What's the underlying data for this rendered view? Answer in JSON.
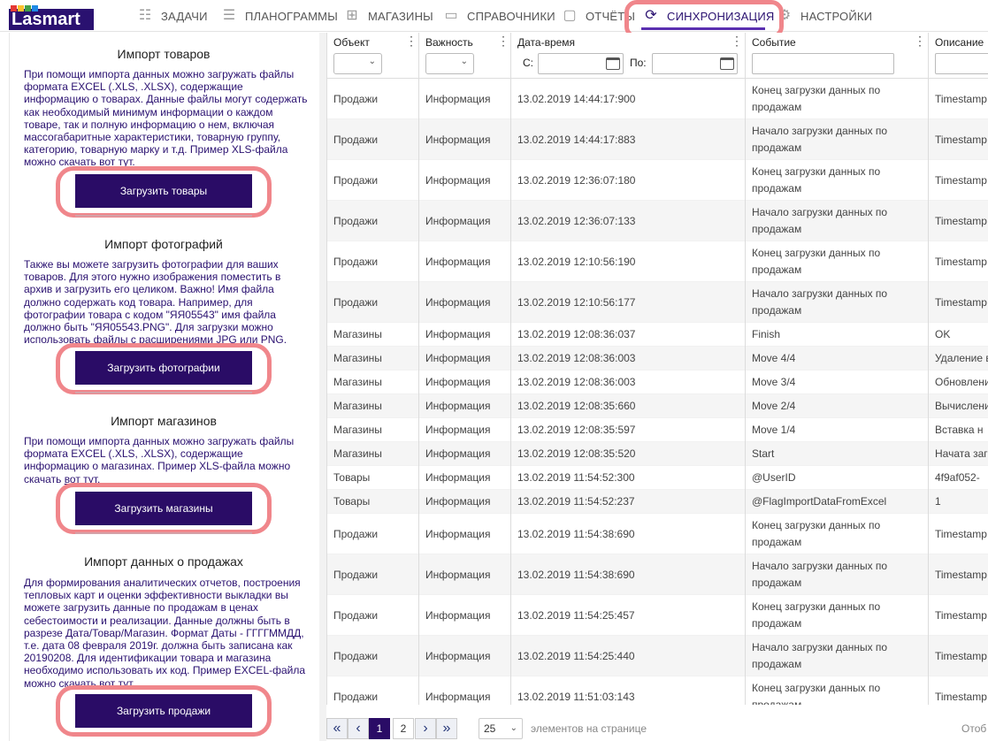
{
  "brand": {
    "logo_text": "Lasmart",
    "logo_colors": [
      "#e53935",
      "#fbc02d",
      "#43a047",
      "#1e88e5"
    ]
  },
  "nav": {
    "items": [
      {
        "label": "ЗАДАЧИ",
        "icon": "checklist-icon"
      },
      {
        "label": "ПЛАНОГРАММЫ",
        "icon": "shelves-icon"
      },
      {
        "label": "МАГАЗИНЫ",
        "icon": "store-icon"
      },
      {
        "label": "СПРАВОЧНИКИ",
        "icon": "folder-icon"
      },
      {
        "label": "ОТЧЁТЫ",
        "icon": "document-icon"
      },
      {
        "label": "СИНХРОНИЗАЦИЯ",
        "icon": "sync-icon",
        "active": true
      },
      {
        "label": "НАСТРОЙКИ",
        "icon": "gear-icon"
      }
    ]
  },
  "sections": [
    {
      "title": "Импорт товаров",
      "text": "При помощи импорта данных можно загружать файлы формата EXCEL (.XLS, .XLSX), содержащие информацию о товарах. Данные файлы могут содержать как необходимый минимум информации о каждом товаре, так и полную информацию о нем, включая массогабаритные характеристики, товарную группу, категорию, товарную марку и т.д. Пример XLS-файла можно скачать",
      "link": "вот тут.",
      "button": "Загрузить товары"
    },
    {
      "title": "Импорт фотографий",
      "text": "Также вы можете загрузить фотографии для ваших товаров. Для этого нужно изображения поместить в архив и загрузить его целиком. Важно! Имя файла должно содержать код товара. Например, для фотографии товара с кодом \"ЯЯ05543\" имя файла должно быть \"ЯЯ05543.PNG\". Для загрузки можно использовать файлы с расширениями JPG или PNG.",
      "link": "",
      "button": "Загрузить фотографии"
    },
    {
      "title": "Импорт магазинов",
      "text": "При помощи импорта данных можно загружать файлы формата EXCEL (.XLS, .XLSX), содержащие информацию о магазинах. Пример XLS-файла можно скачать",
      "link": "вот тут.",
      "button": "Загрузить магазины"
    },
    {
      "title": "Импорт данных о продажах",
      "text": "Для формирования аналитических отчетов, построения тепловых карт и оценки эффективности выкладки вы можете загрузить данные по продажам в ценах себестоимости и реализации. Данные должны быть в разрезе Дата/Товар/Магазин. Формат Даты - ГГГГММДД, т.е. дата 08 февраля 2019г. должна быть записана как 20190208. Для идентификации товара и магазина необходимо использовать их код. Пример EXCEL-файла можно скачать",
      "link": "вот тут.",
      "button": "Загрузить продажи"
    }
  ],
  "grid": {
    "columns": [
      "Объект",
      "Важность",
      "Дата-время",
      "Событие",
      "Описание"
    ],
    "filter": {
      "from_label": "С:",
      "to_label": "По:"
    },
    "rows": [
      [
        "Продажи",
        "Информация",
        "13.02.2019 14:44:17:900",
        "Конец загрузки данных по продажам",
        "Timestamp"
      ],
      [
        "Продажи",
        "Информация",
        "13.02.2019 14:44:17:883",
        "Начало загрузки данных по продажам",
        "Timestamp"
      ],
      [
        "Продажи",
        "Информация",
        "13.02.2019 12:36:07:180",
        "Конец загрузки данных по продажам",
        "Timestamp"
      ],
      [
        "Продажи",
        "Информация",
        "13.02.2019 12:36:07:133",
        "Начало загрузки данных по продажам",
        "Timestamp"
      ],
      [
        "Продажи",
        "Информация",
        "13.02.2019 12:10:56:190",
        "Конец загрузки данных по продажам",
        "Timestamp"
      ],
      [
        "Продажи",
        "Информация",
        "13.02.2019 12:10:56:177",
        "Начало загрузки данных по продажам",
        "Timestamp"
      ],
      [
        "Магазины",
        "Информация",
        "13.02.2019 12:08:36:037",
        "Finish",
        "OK"
      ],
      [
        "Магазины",
        "Информация",
        "13.02.2019 12:08:36:003",
        "Move 4/4",
        "Удаление в"
      ],
      [
        "Магазины",
        "Информация",
        "13.02.2019 12:08:36:003",
        "Move 3/4",
        "Обновлени"
      ],
      [
        "Магазины",
        "Информация",
        "13.02.2019 12:08:35:660",
        "Move 2/4",
        "Вычислени"
      ],
      [
        "Магазины",
        "Информация",
        "13.02.2019 12:08:35:597",
        "Move 1/4",
        "Вставка н"
      ],
      [
        "Магазины",
        "Информация",
        "13.02.2019 12:08:35:520",
        "Start",
        "Начата заг"
      ],
      [
        "Товары",
        "Информация",
        "13.02.2019 11:54:52:300",
        "@UserID",
        "4f9af052-"
      ],
      [
        "Товары",
        "Информация",
        "13.02.2019 11:54:52:237",
        "@FlagImportDataFromExcel",
        "1"
      ],
      [
        "Продажи",
        "Информация",
        "13.02.2019 11:54:38:690",
        "Конец загрузки данных по продажам",
        "Timestamp"
      ],
      [
        "Продажи",
        "Информация",
        "13.02.2019 11:54:38:690",
        "Начало загрузки данных по продажам",
        "Timestamp"
      ],
      [
        "Продажи",
        "Информация",
        "13.02.2019 11:54:25:457",
        "Конец загрузки данных по продажам",
        "Timestamp"
      ],
      [
        "Продажи",
        "Информация",
        "13.02.2019 11:54:25:440",
        "Начало загрузки данных по продажам",
        "Timestamp"
      ],
      [
        "Продажи",
        "Информация",
        "13.02.2019 11:51:03:143",
        "Конец загрузки данных по продажам",
        "Timestamp"
      ]
    ]
  },
  "pager": {
    "first": "«",
    "prev": "‹",
    "pages": [
      "1",
      "2"
    ],
    "current": "1",
    "next": "›",
    "last": "»",
    "page_size": "25",
    "page_size_label": "элементов на странице",
    "right_text": "Отоб"
  }
}
